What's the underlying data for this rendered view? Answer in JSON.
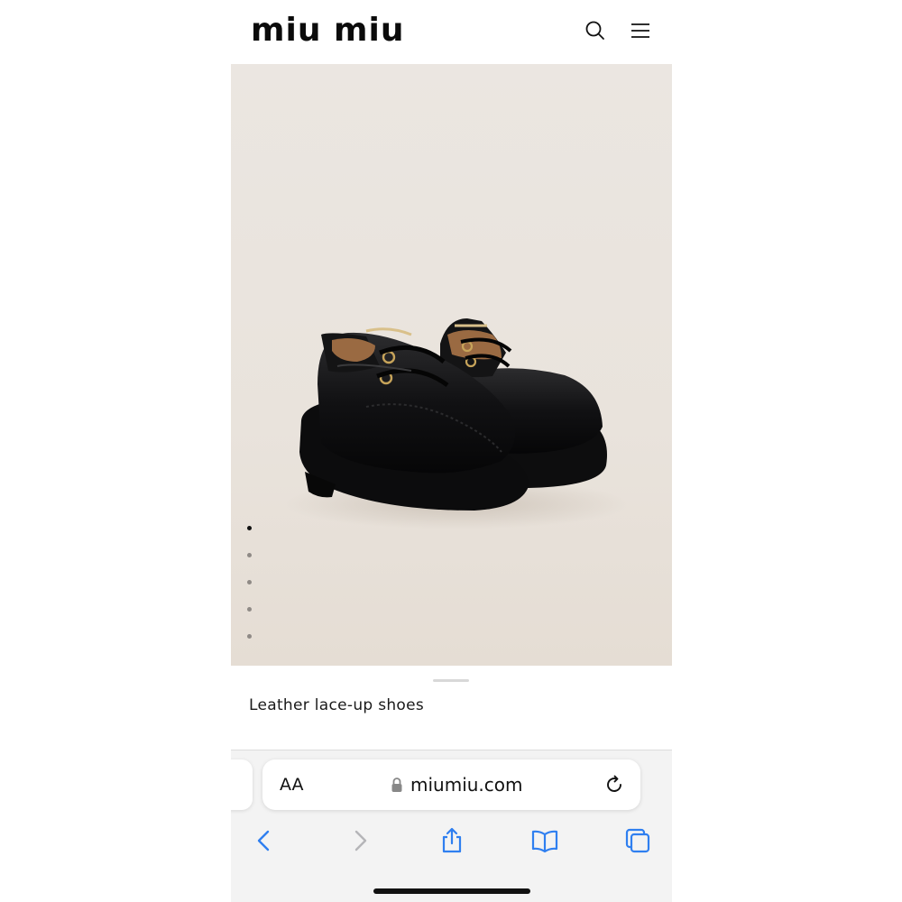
{
  "header": {
    "brand_logo": "miu miu",
    "search_icon": "search-icon",
    "menu_icon": "hamburger-menu-icon"
  },
  "gallery": {
    "image_subject": "shoes",
    "slides_total": 5,
    "active_index": 1
  },
  "product": {
    "title": "Leather lace-up shoes"
  },
  "browser": {
    "text_size_button": "AA",
    "url": "miumiu.com",
    "reload_icon": "reload-icon",
    "toolbar": [
      "back-icon",
      "forward-icon",
      "share-icon",
      "bookmarks-icon",
      "tabs-icon"
    ]
  },
  "colors": {
    "brand_black": "#0b0b0b",
    "hero_background": "#e9e3dc",
    "safari_blue": "#2f7ff0",
    "browser_chrome": "#f3f3f3"
  }
}
